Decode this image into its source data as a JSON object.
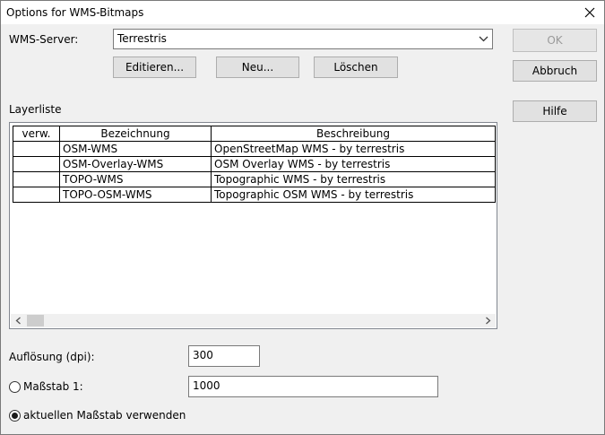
{
  "window": {
    "title": "Options for WMS-Bitmaps"
  },
  "server": {
    "label": "WMS-Server:",
    "selected": "Terrestris"
  },
  "server_buttons": {
    "edit": "Editieren...",
    "new": "Neu...",
    "delete": "Löschen"
  },
  "dialog_buttons": {
    "ok": "OK",
    "cancel": "Abbruch",
    "help": "Hilfe"
  },
  "layers": {
    "label": "Layerliste",
    "columns": [
      "verw.",
      "Bezeichnung",
      "Beschreibung"
    ],
    "rows": [
      {
        "used": "",
        "name": "OSM-WMS",
        "description": "OpenStreetMap WMS - by terrestris"
      },
      {
        "used": "",
        "name": "OSM-Overlay-WMS",
        "description": "OSM Overlay WMS - by terrestris"
      },
      {
        "used": "",
        "name": "TOPO-WMS",
        "description": "Topographic WMS - by terrestris"
      },
      {
        "used": "",
        "name": "TOPO-OSM-WMS",
        "description": "Topographic OSM WMS - by terrestris"
      }
    ]
  },
  "resolution": {
    "label": "Auflösung (dpi):",
    "value": "300"
  },
  "scale": {
    "label": "Maßstab 1:",
    "value": "1000",
    "selected": false
  },
  "current_scale": {
    "label": "aktuellen Maßstab verwenden",
    "selected": true
  }
}
